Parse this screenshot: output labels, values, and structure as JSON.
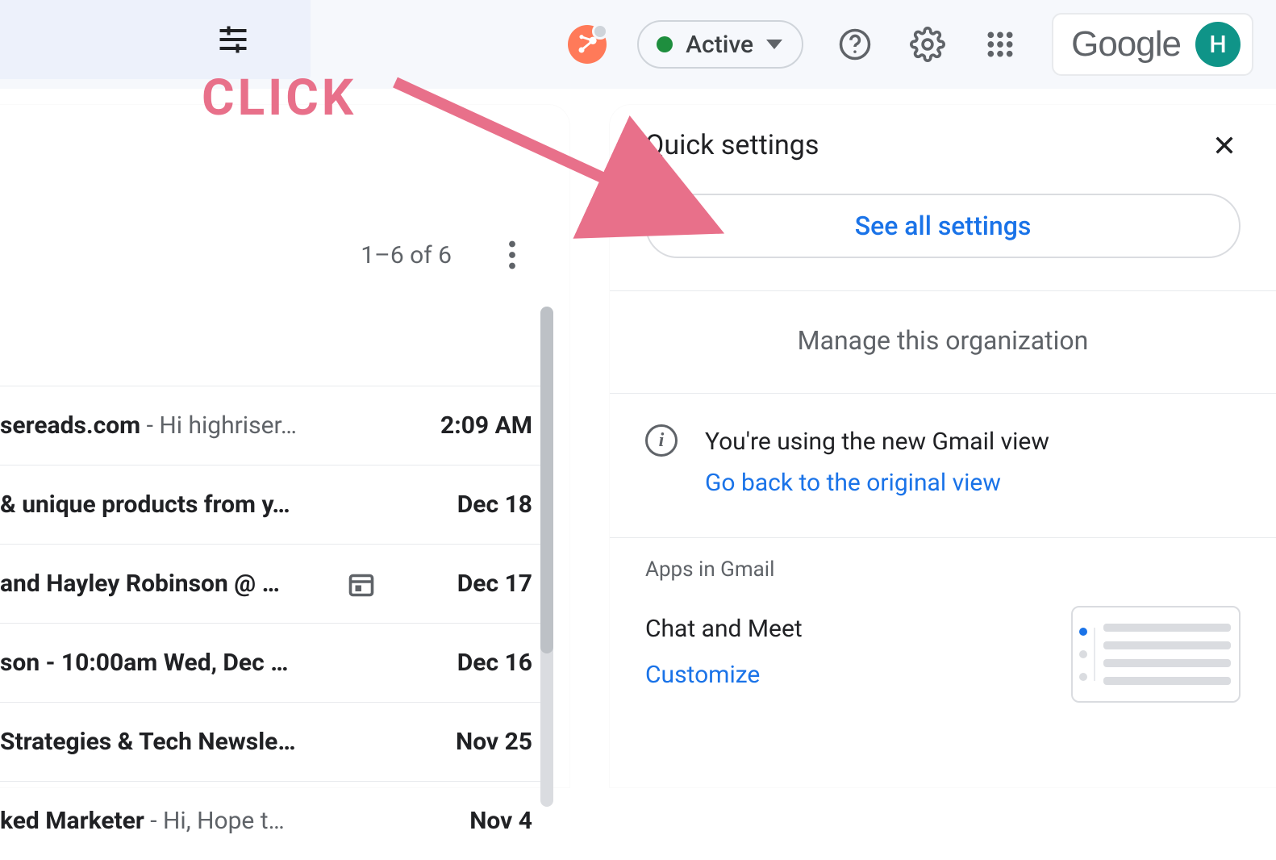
{
  "annotation": {
    "label": "CLICK"
  },
  "header": {
    "status_label": "Active",
    "google_label": "Google",
    "avatar_initial": "H"
  },
  "mail": {
    "count_label": "1–6 of 6",
    "rows": [
      {
        "subject": "sereads.com",
        "preview": " - Hi highriser…",
        "date": "2:09 AM",
        "has_calendar": false
      },
      {
        "subject": "& unique products from y…",
        "preview": "",
        "date": "Dec 18",
        "has_calendar": false
      },
      {
        "subject": " and Hayley Robinson @ …",
        "preview": "",
        "date": "Dec 17",
        "has_calendar": true
      },
      {
        "subject": "son - 10:00am Wed, Dec …",
        "preview": "",
        "date": "Dec 16",
        "has_calendar": false
      },
      {
        "subject": "Strategies & Tech Newsle…",
        "preview": "",
        "date": "Nov 25",
        "has_calendar": false
      },
      {
        "subject": "ked Marketer",
        "preview": " - Hi, Hope t…",
        "date": "Nov 4",
        "has_calendar": false
      }
    ]
  },
  "qs": {
    "title": "Quick settings",
    "see_all": "See all settings",
    "manage_org": "Manage this organization",
    "new_view_msg": "You're using the new Gmail view",
    "go_back": "Go back to the original view",
    "apps_section": "Apps in Gmail",
    "chat_meet": "Chat and Meet",
    "customize": "Customize"
  }
}
